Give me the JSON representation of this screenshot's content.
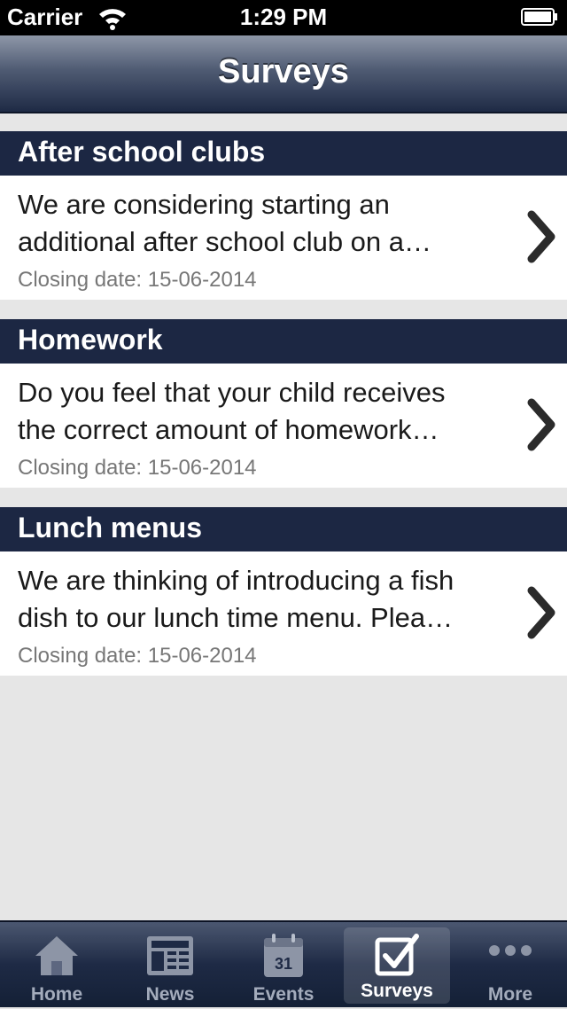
{
  "status_bar": {
    "carrier": "Carrier",
    "time": "1:29 PM"
  },
  "nav": {
    "title": "Surveys"
  },
  "surveys": [
    {
      "title": "After school clubs",
      "description": "We are considering starting an additional after school club on a…",
      "closing": "Closing date: 15-06-2014"
    },
    {
      "title": "Homework",
      "description": "Do you feel that your child receives the correct amount of homework…",
      "closing": "Closing date: 15-06-2014"
    },
    {
      "title": "Lunch menus",
      "description": "We are thinking of introducing a fish dish to our lunch time menu.  Plea…",
      "closing": "Closing date: 15-06-2014"
    }
  ],
  "tab_bar": {
    "tabs": [
      {
        "label": "Home",
        "icon": "home-icon"
      },
      {
        "label": "News",
        "icon": "news-icon"
      },
      {
        "label": "Events",
        "icon": "calendar-icon",
        "icon_text": "31"
      },
      {
        "label": "Surveys",
        "icon": "checkbox-icon",
        "selected": true
      },
      {
        "label": "More",
        "icon": "more-dots-icon"
      }
    ]
  },
  "colors": {
    "header_navy": "#1c2743",
    "background": "#e6e6e6",
    "closing_text": "#777777"
  }
}
